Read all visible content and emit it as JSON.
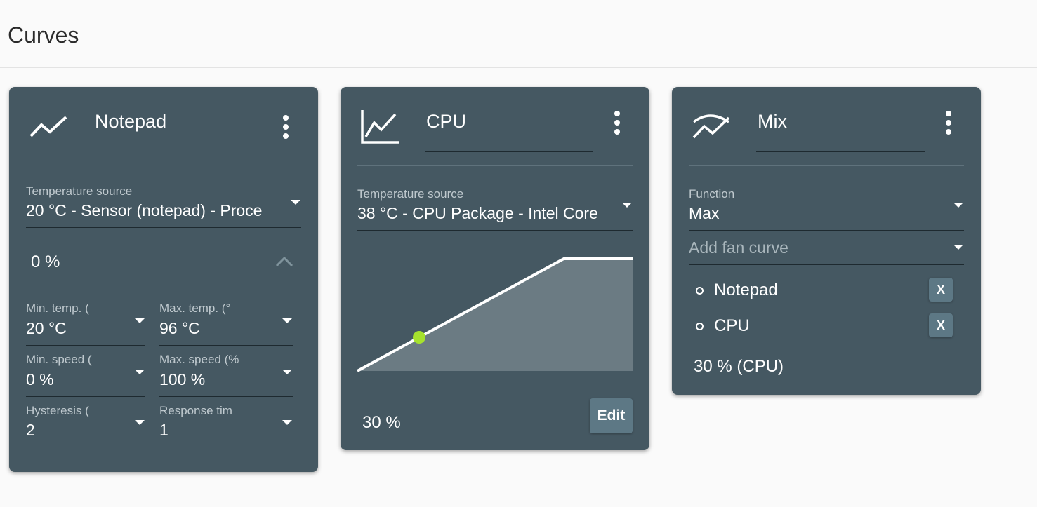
{
  "page": {
    "title": "Curves"
  },
  "colors": {
    "card_bg": "#455862",
    "page_bg": "#fafafa",
    "point": "#a6e22e",
    "area": "#6b7b83"
  },
  "cards": {
    "notepad": {
      "icon": "trend-line-icon",
      "name": "Notepad",
      "temp_source_label": "Temperature source",
      "temp_source_value": "20 °C - Sensor (notepad) - Proce",
      "speed": "0 %",
      "fields": [
        {
          "label": "Min. temp. (",
          "value": "20 °C"
        },
        {
          "label": "Max. temp. (°",
          "value": "96 °C"
        },
        {
          "label": "Min. speed (",
          "value": "0 %"
        },
        {
          "label": "Max. speed (%",
          "value": "100 %"
        },
        {
          "label": "Hysteresis (",
          "value": "2"
        },
        {
          "label": "Response tim",
          "value": "1"
        }
      ]
    },
    "cpu": {
      "icon": "graph-icon",
      "name": "CPU",
      "temp_source_label": "Temperature source",
      "temp_source_value": "38 °C - CPU Package - Intel Core",
      "speed": "30 %",
      "edit_label": "Edit"
    },
    "mix": {
      "icon": "mix-curves-icon",
      "name": "Mix",
      "function_label": "Function",
      "function_value": "Max",
      "add_placeholder": "Add fan curve",
      "curves": [
        {
          "name": "Notepad",
          "remove_label": "X"
        },
        {
          "name": "CPU",
          "remove_label": "X"
        }
      ],
      "speed": "30 % (CPU)"
    }
  }
}
